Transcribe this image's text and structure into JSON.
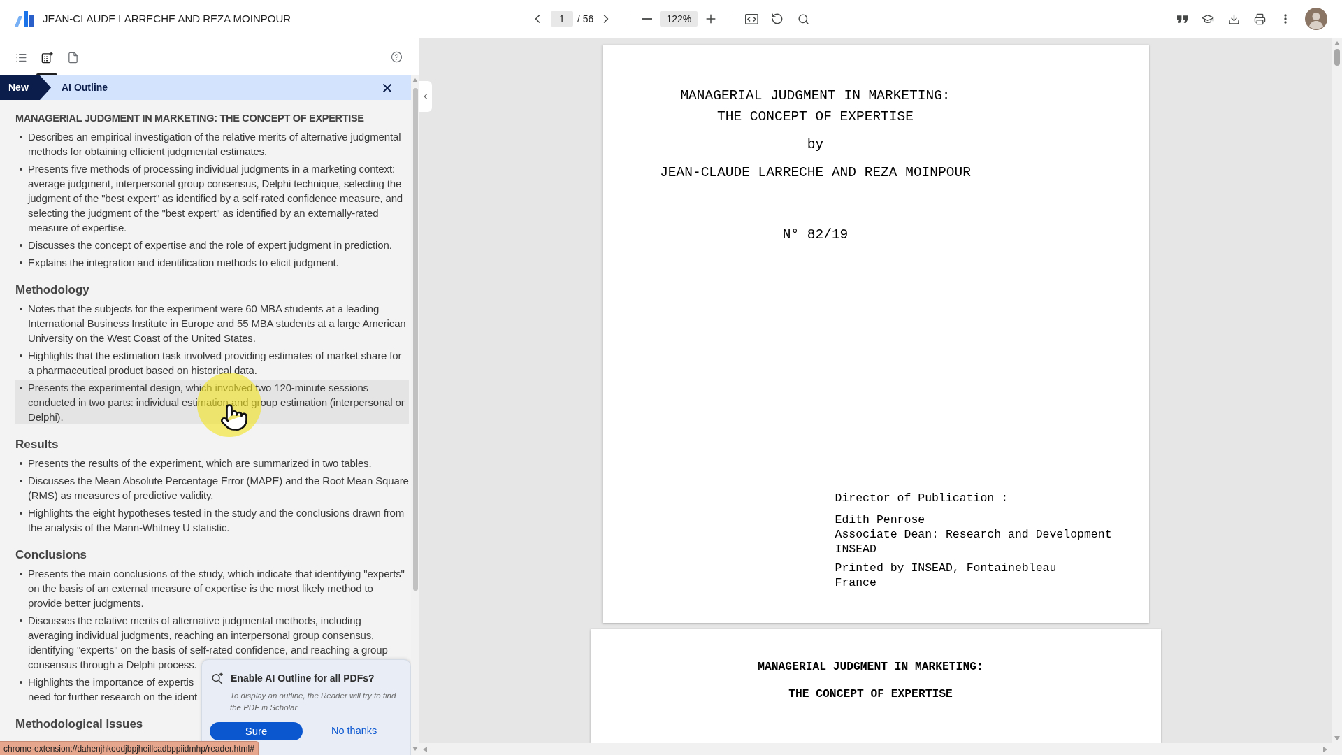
{
  "header": {
    "title": "JEAN-CLAUDE LARRECHE AND REZA MOINPOUR"
  },
  "toolbar": {
    "page": "1",
    "page_count": "/ 56",
    "zoom": "122%"
  },
  "sidebar": {
    "tabs": [
      {
        "kind": "list",
        "selected": false
      },
      {
        "kind": "outline",
        "selected": true
      },
      {
        "kind": "page",
        "selected": false
      }
    ],
    "banner": {
      "badge": "New",
      "title": "AI Outline"
    },
    "outline": [
      {
        "kind": "title",
        "heading": "MANAGERIAL JUDGMENT IN MARKETING: THE CONCEPT OF EXPERTISE",
        "items": [
          {
            "text": "Describes an empirical investigation of the relative merits of alternative judgmental methods for obtaining efficient judgmental estimates.",
            "hovered": false
          },
          {
            "text": "Presents five methods of processing individual judgments in a marketing context: average judgment, interpersonal group consensus, Delphi technique, selecting the judgment of the \"best expert\" as identified by a self-rated confidence measure, and selecting the judgment of the \"best expert\" as identified by an externally-rated measure of expertise.",
            "hovered": false
          },
          {
            "text": "Discusses the concept of expertise and the role of expert judgment in prediction.",
            "hovered": false
          },
          {
            "text": "Explains the integration and identification methods to elicit judgment.",
            "hovered": false
          }
        ]
      },
      {
        "kind": "section",
        "heading": "Methodology",
        "items": [
          {
            "text": "Notes that the subjects for the experiment were 60 MBA students at a leading International Business Institute in Europe and 55 MBA students at a large American University on the West Coast of the United States.",
            "hovered": false
          },
          {
            "text": "Highlights that the estimation task involved providing estimates of market share for a pharmaceutical product based on historical data.",
            "hovered": false
          },
          {
            "text": "Presents the experimental design, which involved two 120-minute sessions conducted in two parts: individual estimation and group estimation (interpersonal or Delphi).",
            "hovered": true
          }
        ]
      },
      {
        "kind": "section",
        "heading": "Results",
        "items": [
          {
            "text": "Presents the results of the experiment, which are summarized in two tables.",
            "hovered": false
          },
          {
            "text": "Discusses the Mean Absolute Percentage Error (MAPE) and the Root Mean Square (RMS) as measures of predictive validity.",
            "hovered": false
          },
          {
            "text": "Highlights the eight hypotheses tested in the study and the conclusions drawn from the analysis of the Mann-Whitney U statistic.",
            "hovered": false
          }
        ]
      },
      {
        "kind": "section",
        "heading": "Conclusions",
        "items": [
          {
            "text": "Presents the main conclusions of the study, which indicate that identifying \"experts\" on the basis of an external measure of expertise is the most likely method to provide better judgments.",
            "hovered": false
          },
          {
            "text": "Discusses the relative merits of alternative judgmental methods, including averaging individual judgments, reaching an interpersonal group consensus, identifying \"experts\" on the basis of self-rated confidence, and reaching a group consensus through a Delphi process.",
            "hovered": false
          },
          {
            "lines": [
              "Highlights the importance of expertis",
              "need for further research on the ident"
            ],
            "hovered": false
          }
        ]
      },
      {
        "kind": "section",
        "heading": "Methodological Issues"
      }
    ]
  },
  "popup": {
    "title": "Enable AI Outline for all PDFs?",
    "body": "To display an outline, the Reader will try to find the PDF in Scholar",
    "buttons": [
      {
        "label": "Sure",
        "kind": "primary"
      },
      {
        "label": "No thanks",
        "kind": "text"
      }
    ]
  },
  "document": {
    "pages": [
      {
        "kind": "cover",
        "title_lines": [
          "MANAGERIAL JUDGMENT IN MARKETING:",
          "THE CONCEPT OF EXPERTISE"
        ],
        "byline": "by",
        "authors": "JEAN-CLAUDE LARRECHE AND REZA MOINPOUR",
        "number": "N° 82/19",
        "publication": [
          {
            "lines": [
              "Director of Publication :"
            ]
          },
          {
            "lines": [
              "Edith Penrose",
              "Associate Dean: Research and Development",
              "INSEAD"
            ]
          },
          {
            "lines": [
              "Printed by INSEAD, Fontainebleau",
              "France"
            ]
          }
        ]
      },
      {
        "kind": "title_page",
        "title_lines": [
          "MANAGERIAL JUDGMENT IN MARKETING:",
          "THE CONCEPT OF EXPERTISE"
        ]
      }
    ]
  },
  "status_url": "chrome-extension://dahenjhkoodjbpjheillcadbppiidmhp/reader.html#"
}
